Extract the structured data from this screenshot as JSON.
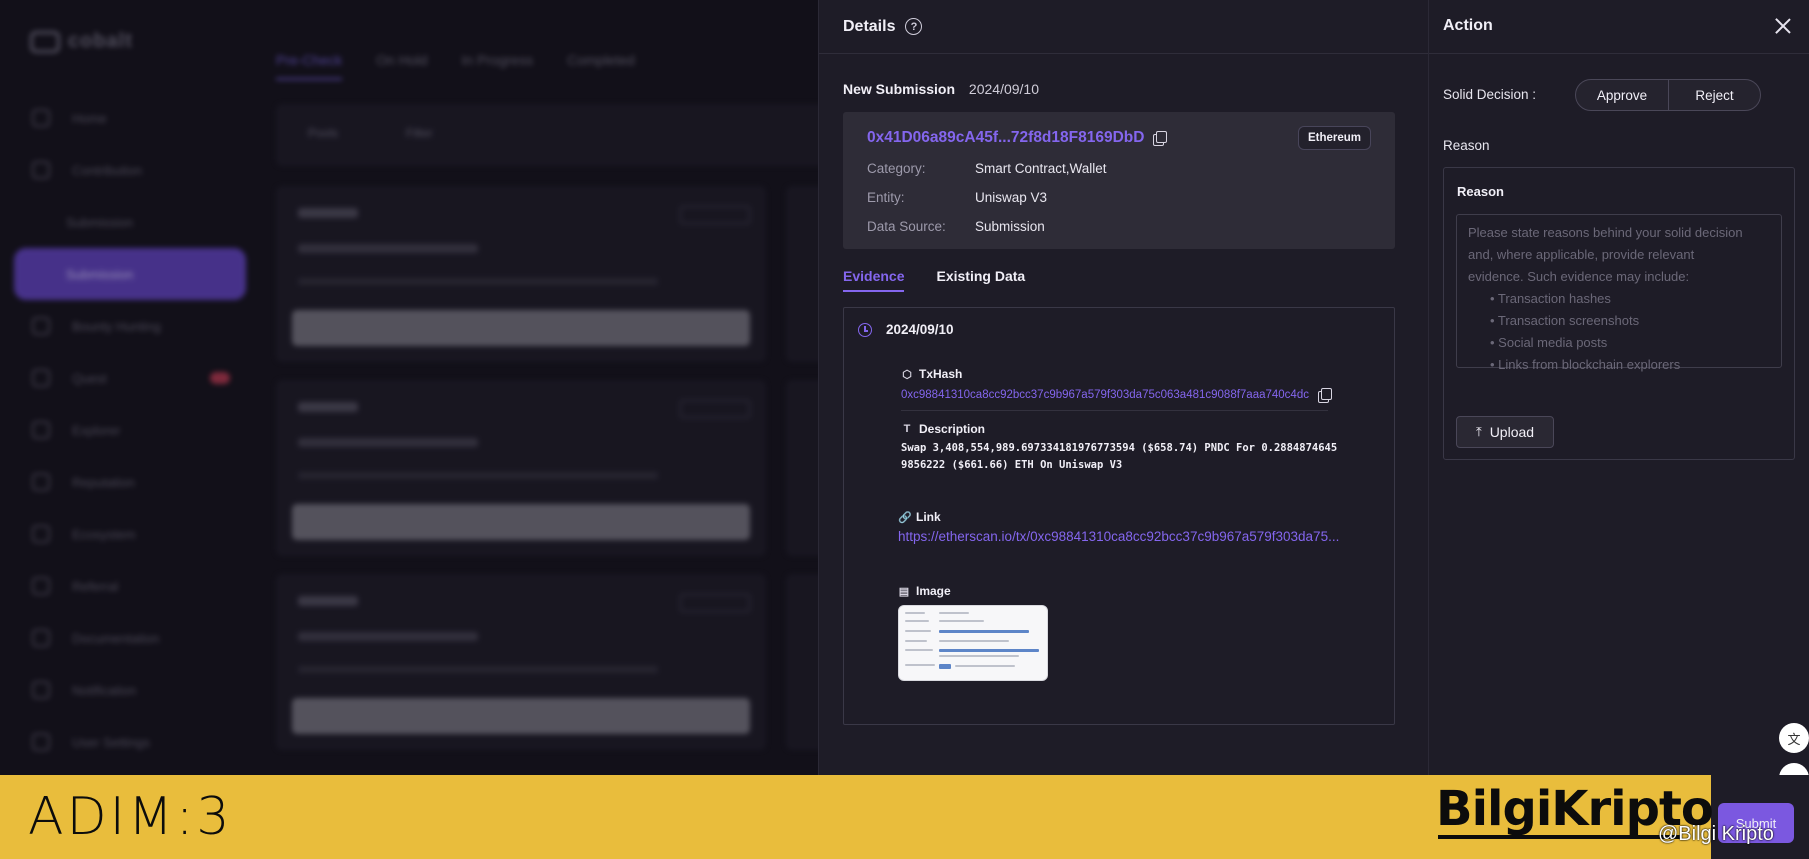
{
  "background": {
    "app_name": "cobalt",
    "tabs": [
      "Pre-Check",
      "On Hold",
      "In Progress",
      "Completed"
    ],
    "sidebar": [
      "Home",
      "Contribution",
      "Submission",
      "Submission",
      "Bounty Hunting",
      "Quest",
      "Explorer",
      "Reputation",
      "Ecosystem",
      "Referral",
      "Documentation",
      "Notification",
      "User Settings"
    ],
    "toolbar": [
      "Pools",
      "Filter"
    ]
  },
  "details": {
    "title": "Details",
    "help_icon_glyph": "?",
    "status": "New Submission",
    "date": "2024/09/10",
    "address": "0x41D06a89cA45f...72f8d18F8169DbD",
    "chain": "Ethereum",
    "fields": [
      {
        "key": "Category:",
        "value": "Smart Contract,Wallet"
      },
      {
        "key": "Entity:",
        "value": "Uniswap V3"
      },
      {
        "key": "Data Source:",
        "value": "Submission"
      }
    ],
    "tabs": [
      {
        "label": "Evidence",
        "active": true
      },
      {
        "label": "Existing Data",
        "active": false
      }
    ],
    "evidence": {
      "date": "2024/09/10",
      "txhash_label": "TxHash",
      "txhash": "0xc98841310ca8cc92bcc37c9b967a579f303da75c063a481c9088f7aaa740c4dc",
      "description_label": "Description",
      "description_line1": "Swap 3,408,554,989.697334181976773594 ($658.74) PNDC For 0.2884874645",
      "description_line2": "9856222 ($661.66) ETH On Uniswap V3",
      "link_label": "Link",
      "link": "https://etherscan.io/tx/0xc98841310ca8cc92bcc37c9b967a579f303da75...",
      "image_label": "Image"
    }
  },
  "action": {
    "title": "Action",
    "decision_label": "Solid Decision :",
    "approve_label": "Approve",
    "reject_label": "Reject",
    "reason_label": "Reason",
    "reason_box_label": "Reason",
    "reason_placeholder_lines": [
      "Please state reasons behind your solid decision",
      "and, where applicable, provide relevant",
      "evidence. Such evidence may include:"
    ],
    "reason_bullets": [
      "• Transaction hashes",
      "• Transaction screenshots",
      "• Social media posts",
      "• Links from blockchain explorers"
    ],
    "upload_label": "Upload",
    "submit_label": "Submit"
  },
  "banner": {
    "step": "ADIM:3",
    "brand": "BilgiKripto",
    "handle": "@Bilgi Kripto"
  },
  "icons": {
    "help": "question-circle-icon",
    "copy": "copy-icon",
    "clock": "clock-icon",
    "close": "close-icon",
    "upload": "upload-icon",
    "translate": "translate-icon",
    "assistant": "assistant-icon"
  },
  "colors": {
    "accent": "#8466ee",
    "panel": "#1e1c27",
    "banner": "#e9bd3c"
  }
}
